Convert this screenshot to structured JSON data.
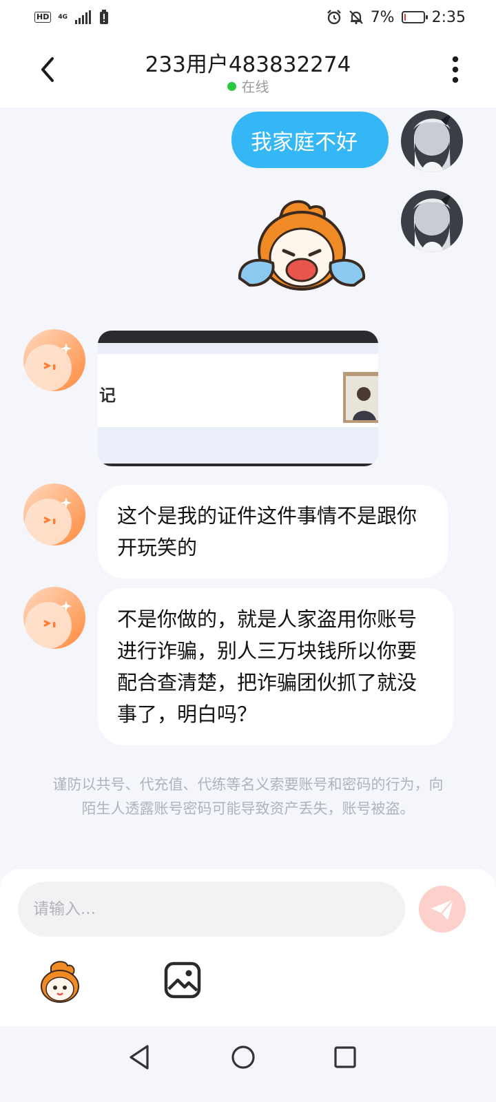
{
  "status_bar": {
    "network_badge": "HD",
    "network_type": "4G",
    "battery": "7%",
    "battery_level": 0.07,
    "time": "2:35",
    "icons": [
      "hd-icon",
      "signal-icon",
      "battery-alert-icon",
      "alarm-icon",
      "mute-icon",
      "battery-icon"
    ]
  },
  "header": {
    "title": "233用户483832274",
    "status": "在线",
    "status_color": "#2ac940"
  },
  "messages": [
    {
      "from": "me",
      "type": "text",
      "text": "我家庭不好"
    },
    {
      "from": "me",
      "type": "sticker",
      "sticker": "crying-mascot"
    },
    {
      "from": "other",
      "type": "image",
      "visible_text": "记"
    },
    {
      "from": "other",
      "type": "text",
      "text": "这个是我的证件这件事情不是跟你开玩笑的"
    },
    {
      "from": "other",
      "type": "text",
      "text": "不是你做的，就是人家盗用你账号进行诈骗，别人三万块钱所以你要配合查清楚，把诈骗团伙抓了就没事了，明白吗？"
    }
  ],
  "notice": "谨防以共号、代充值、代练等名义索要账号和密码的行为，向陌生人透露账号密码可能导致资产丢失，账号被盗。",
  "input": {
    "placeholder": "请输入..."
  },
  "colors": {
    "accent": "#35b6f5",
    "send_button": "#fcd1cc",
    "background": "#f4f6fb"
  }
}
